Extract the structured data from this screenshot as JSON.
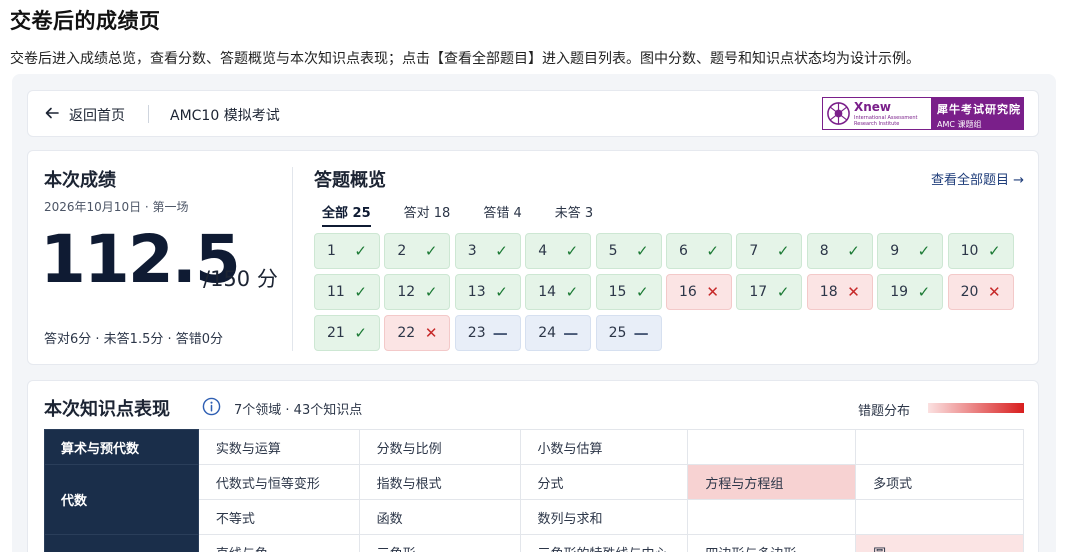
{
  "page": {
    "title": "交卷后的成绩页",
    "description": "交卷后进入成绩总览，查看分数、答题概览与本次知识点表现；点击【查看全部题目】进入题目列表。图中分数、题号和知识点状态均为设计示例。"
  },
  "topbar": {
    "back_label": "返回首页",
    "exam_name": "AMC10 模拟考试",
    "logo": {
      "brand": "Xnew",
      "brand_sub": "International Assessment Research Institute",
      "cn_name": "犀牛考试研究院",
      "cn_sub": "AMC 课题组"
    }
  },
  "score": {
    "title": "本次成绩",
    "date": "2026年10月10日 · 第一场",
    "value": "112.5",
    "total": "/150 分",
    "breakdown": "答对6分 · 未答1.5分 · 答错0分"
  },
  "overview": {
    "title": "答题概览",
    "link": "查看全部题目 →",
    "tabs": [
      {
        "label": "全部 25",
        "active": true
      },
      {
        "label": "答对 18",
        "active": false
      },
      {
        "label": "答错 4",
        "active": false
      },
      {
        "label": "未答 3",
        "active": false
      }
    ],
    "questions": [
      {
        "n": "1",
        "s": "correct"
      },
      {
        "n": "2",
        "s": "correct"
      },
      {
        "n": "3",
        "s": "correct"
      },
      {
        "n": "4",
        "s": "correct"
      },
      {
        "n": "5",
        "s": "correct"
      },
      {
        "n": "6",
        "s": "correct"
      },
      {
        "n": "7",
        "s": "correct"
      },
      {
        "n": "8",
        "s": "correct"
      },
      {
        "n": "9",
        "s": "correct"
      },
      {
        "n": "10",
        "s": "correct"
      },
      {
        "n": "11",
        "s": "correct"
      },
      {
        "n": "12",
        "s": "correct"
      },
      {
        "n": "13",
        "s": "correct"
      },
      {
        "n": "14",
        "s": "correct"
      },
      {
        "n": "15",
        "s": "correct"
      },
      {
        "n": "16",
        "s": "wrong"
      },
      {
        "n": "17",
        "s": "correct"
      },
      {
        "n": "18",
        "s": "wrong"
      },
      {
        "n": "19",
        "s": "correct"
      },
      {
        "n": "20",
        "s": "wrong"
      },
      {
        "n": "21",
        "s": "correct"
      },
      {
        "n": "22",
        "s": "wrong"
      },
      {
        "n": "23",
        "s": "blank"
      },
      {
        "n": "24",
        "s": "blank"
      },
      {
        "n": "25",
        "s": "blank"
      }
    ],
    "marks": {
      "correct": "✓",
      "wrong": "✕",
      "blank": "—"
    }
  },
  "knowledge": {
    "title": "本次知识点表现",
    "summary": "7个领域 · 43个知识点",
    "legend": "错题分布",
    "rows": [
      {
        "domain": "算术与预代数",
        "cells": [
          {
            "t": "实数与运算"
          },
          {
            "t": "分数与比例"
          },
          {
            "t": "小数与估算"
          },
          {
            "t": ""
          },
          {
            "t": ""
          }
        ]
      },
      {
        "domain": "代数",
        "cells": [
          {
            "t": "代数式与恒等变形"
          },
          {
            "t": "指数与根式"
          },
          {
            "t": "分式"
          },
          {
            "t": "方程与方程组",
            "h": "hot"
          },
          {
            "t": "多项式"
          }
        ]
      },
      {
        "domain": "",
        "cells": [
          {
            "t": "不等式"
          },
          {
            "t": "函数"
          },
          {
            "t": "数列与求和"
          },
          {
            "t": ""
          },
          {
            "t": ""
          }
        ]
      },
      {
        "domain": "",
        "cells": [
          {
            "t": "直线与角"
          },
          {
            "t": "三角形"
          },
          {
            "t": "三角形的特殊线与中心"
          },
          {
            "t": "四边形与多边形"
          },
          {
            "t": "圆",
            "h": "hot2"
          }
        ]
      }
    ]
  },
  "colors": {
    "accent": "#0f1b33",
    "correct": "#1c7a35",
    "wrong": "#c62828",
    "brand": "#7a1f8a"
  }
}
